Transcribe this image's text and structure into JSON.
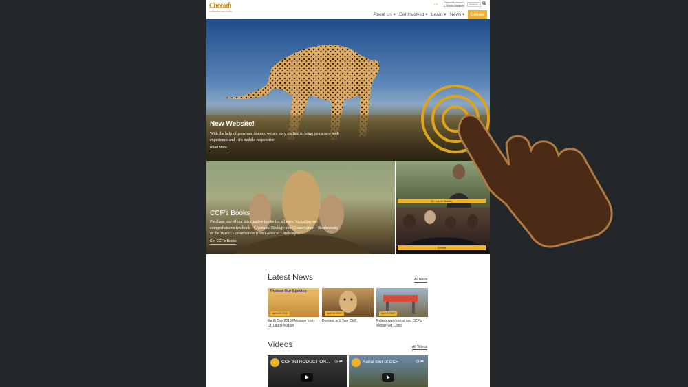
{
  "header": {
    "logo_text": "Cheetah",
    "logo_sub": "CONSERVATION FUND",
    "lang_label": "EN",
    "select_language": "Select Langua",
    "search_placeholder": "Search",
    "nav": [
      {
        "label": "About Us ▾"
      },
      {
        "label": "Get Involved ▾"
      },
      {
        "label": "Learn ▾"
      },
      {
        "label": "News ▾"
      }
    ],
    "donate": "Donate"
  },
  "hero": {
    "title": "New Website!",
    "text": "With the help of generous donors, we are very excited to bring you a new web experience and - it's mobile responsive!",
    "cta": "Read More"
  },
  "books": {
    "title": "CCF's Books",
    "text": "Purchase one of our informative books for all ages, including our comprehensive textbook - Cheetahs: Biology and Conservation - Biodiversity of the World: Conservation from Genes to Landscapes",
    "cta": "Get CCF's Books"
  },
  "tiles": [
    {
      "caption": "Dr. Laurie Marker"
    },
    {
      "caption": "Events"
    }
  ],
  "latest_news": {
    "title": "Latest News",
    "all_link": "All News",
    "items": [
      {
        "banner": "Protect Our Species",
        "date": "April 22, 2019",
        "caption": "Earth Day 2019 Message from Dr. Laurie Marker"
      },
      {
        "banner": "",
        "date": "April 16, 2019",
        "caption": "Dominic is 1 Year Old!!"
      },
      {
        "banner": "",
        "date": "April 8, 2019",
        "caption": "Rabies Awareness and CCF's Mobile Vet Clinic"
      }
    ]
  },
  "videos": {
    "title": "Videos",
    "all_link": "All Videos",
    "items": [
      {
        "title": "CCF INTRODUCTION..."
      },
      {
        "title": "Aerial tour of CCF"
      }
    ]
  },
  "colors": {
    "accent": "#f0b229",
    "background": "#24272a",
    "hand": "#4b2a16"
  }
}
